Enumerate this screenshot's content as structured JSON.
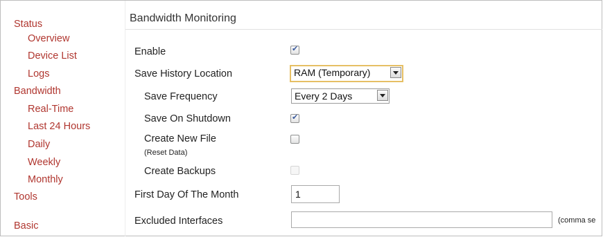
{
  "sidebar": {
    "items": [
      {
        "label": "Status"
      },
      {
        "label": "Overview"
      },
      {
        "label": "Device List"
      },
      {
        "label": "Logs"
      },
      {
        "label": "Bandwidth"
      },
      {
        "label": "Real-Time"
      },
      {
        "label": "Last 24 Hours"
      },
      {
        "label": "Daily"
      },
      {
        "label": "Weekly"
      },
      {
        "label": "Monthly"
      },
      {
        "label": "Tools"
      },
      {
        "label": "Basic"
      }
    ]
  },
  "main": {
    "title": "Bandwidth Monitoring",
    "enable": {
      "label": "Enable",
      "checked": true
    },
    "save_history_location": {
      "label": "Save History Location",
      "value": "RAM (Temporary)"
    },
    "save_frequency": {
      "label": "Save Frequency",
      "value": "Every 2 Days"
    },
    "save_on_shutdown": {
      "label": "Save On Shutdown",
      "checked": true
    },
    "create_new_file": {
      "label": "Create New File",
      "sublabel": "(Reset Data)",
      "checked": false
    },
    "create_backups": {
      "label": "Create Backups",
      "checked": false,
      "disabled": true
    },
    "first_day_of_month": {
      "label": "First Day Of The Month",
      "value": "1"
    },
    "excluded_interfaces": {
      "label": "Excluded Interfaces",
      "value": "",
      "note": "(comma se"
    }
  }
}
